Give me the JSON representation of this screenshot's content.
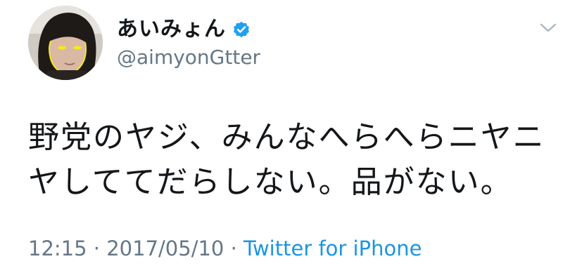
{
  "user": {
    "display_name": "あいみょん",
    "handle": "@aimyonGtter",
    "verified": true,
    "verified_icon": "verified-badge-icon"
  },
  "tweet": {
    "text": "野党のヤジ、みんなへらへらニヤニヤしててだらしない。品がない。",
    "time": "12:15",
    "separator": "·",
    "date": "2017/05/10",
    "source": "Twitter for iPhone"
  },
  "colors": {
    "verified": "#1da1f2",
    "meta_gray": "#657786",
    "link_blue": "#1b95e0"
  },
  "icons": {
    "menu": "chevron-down-icon"
  }
}
